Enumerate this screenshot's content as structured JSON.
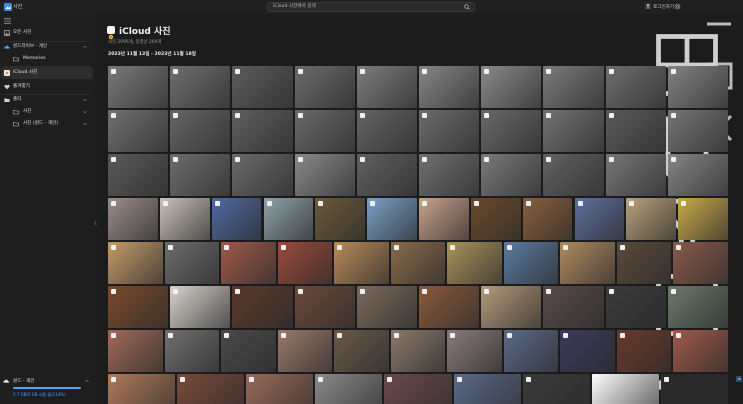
{
  "app": {
    "title": "사진"
  },
  "search": {
    "placeholder": "iCloud 사진에서 검색"
  },
  "account": {
    "signin_label": "로그인하기"
  },
  "sidebar": {
    "items": [
      {
        "label": "모든 사진",
        "icon": "gallery-icon"
      },
      {
        "label": "원드라이브 - 개인",
        "icon": "cloud-icon"
      },
      {
        "label": "Memories",
        "icon": "folder-icon"
      },
      {
        "label": "iCloud 사진",
        "icon": "icloud-icon"
      },
      {
        "label": "즐겨찾기",
        "icon": "heart-icon"
      },
      {
        "label": "폴더",
        "icon": "folder-icon"
      },
      {
        "label": "사진",
        "icon": "folder-icon"
      },
      {
        "label": "사진 (원드 - 개인)",
        "icon": "folder-icon"
      }
    ],
    "storage": {
      "title": "원드 - 개인",
      "text": "5.7 GB/5 GB 사용 중(114%)",
      "used_fraction": 1.0
    }
  },
  "main": {
    "title": "iCloud 사진",
    "subtitle": "사진 2096개, 동영상 264개",
    "date_range": "2023년 11월 13일 - 2023년 11월 18일"
  },
  "colors": {
    "accent": "#4aa3ff",
    "photos": [
      [
        "#7a7a7a",
        "#6f6f6f",
        "#5c5c5c",
        "#6b6b6b",
        "#7d7d7d",
        "#868686",
        "#8a8a8a",
        "#7b7b7b",
        "#6e6e6e",
        "#828282"
      ],
      [
        "#707070",
        "#656565",
        "#5f5f5f",
        "#6a6a6a",
        "#646464",
        "#6c6c6c",
        "#696969",
        "#737373",
        "#5b5b5b",
        "#757575"
      ],
      [
        "#5a5a5a",
        "#6d6d6d",
        "#6a6a6a",
        "#8a8a8a",
        "#606060",
        "#707070",
        "#7a7a7a",
        "#626262",
        "#777777",
        "#858585"
      ],
      [
        "#9a8d8a",
        "#c9c1b8",
        "#4f6aa0",
        "#8ea2a8",
        "#6b5a3a",
        "#7aa0c8",
        "#caa28a",
        "#6a4a2a",
        "#8b5e3c",
        "#5d6f9c",
        "#b8a27a",
        "#caa94a"
      ],
      [
        "#c49a6a",
        "#6d6d6d",
        "#a05a48",
        "#9a4a3a",
        "#b88a5a",
        "#8a6a4a",
        "#a8935a",
        "#5a7aa0",
        "#b08a60",
        "#5a4a3a",
        "#8a5a4a"
      ],
      [
        "#7a4a2a",
        "#d6d2cc",
        "#5a3a2a",
        "#6a4a3a",
        "#7a6a5a",
        "#8a5a3a",
        "#b39a7a",
        "#5a4a4a",
        "#3a3a3a",
        "#6a7a6a"
      ],
      [
        "#a06a5a",
        "#707070",
        "#4a4a4a",
        "#9a7a6a",
        "#6a5a4a",
        "#8a7a6a",
        "#8a7a7a",
        "#5a6a8a",
        "#3a3a5a",
        "#6a3a2a",
        "#a05a4a"
      ],
      [
        "#b07a5a",
        "#7a4a3a",
        "#9a6a5a",
        "#8a8a8a",
        "#6a4a4a",
        "#5a6a8a",
        "#3a3a3a",
        "#ffffff",
        "#2a2a2a"
      ]
    ]
  }
}
